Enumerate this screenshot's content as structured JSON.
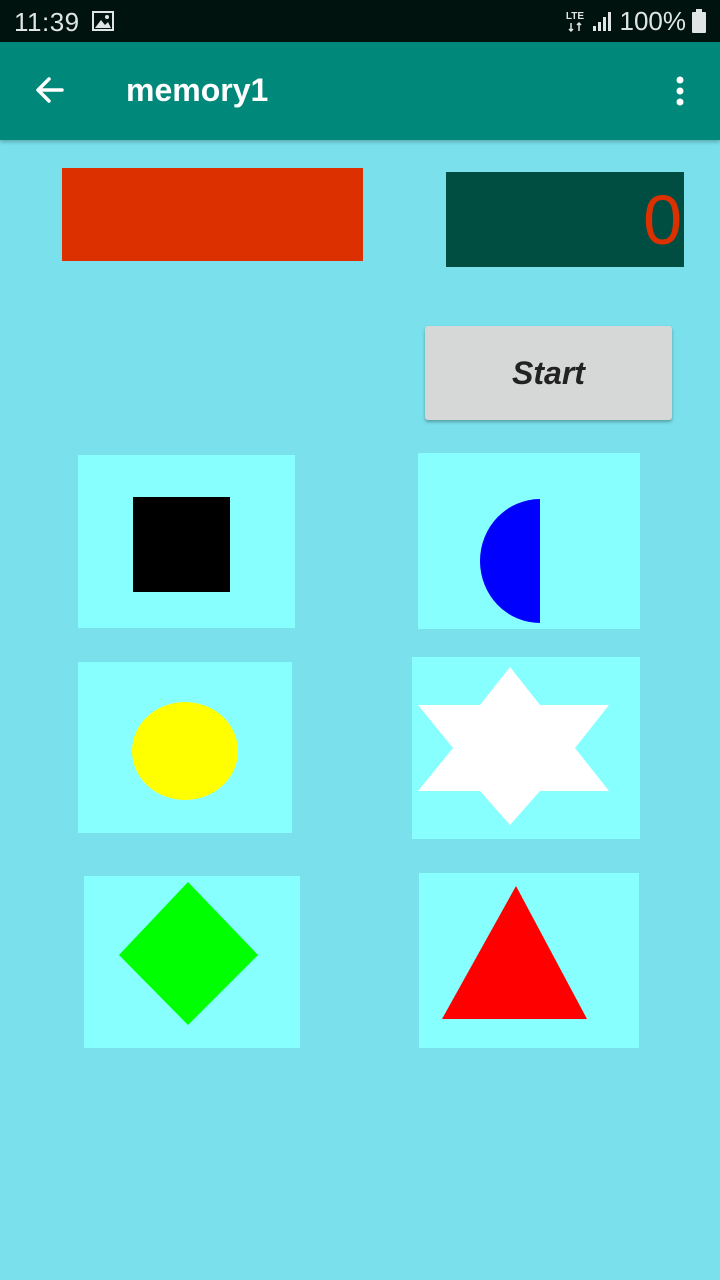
{
  "status_bar": {
    "time": "11:39",
    "network": "LTE",
    "battery": "100%",
    "icons": [
      "image-icon",
      "lte-icon",
      "signal-icon",
      "battery-icon"
    ]
  },
  "app_bar": {
    "title": "memory1",
    "back_icon": "arrow-back-icon",
    "menu_icon": "more-vert-icon"
  },
  "game": {
    "indicator_color": "#dd3000",
    "score": "0",
    "score_color": "#dd3000",
    "score_background": "#004e42",
    "start_label": "Start"
  },
  "cards": [
    {
      "shape": "square",
      "color": "#000000"
    },
    {
      "shape": "half-circle",
      "color": "#0000ff"
    },
    {
      "shape": "circle",
      "color": "#ffff00"
    },
    {
      "shape": "star",
      "color": "#ffffff"
    },
    {
      "shape": "diamond",
      "color": "#00ff00"
    },
    {
      "shape": "triangle",
      "color": "#ff0000"
    }
  ],
  "colors": {
    "app_bar": "#00897b",
    "background": "#7ae1ec",
    "card_background": "#88ffff"
  }
}
